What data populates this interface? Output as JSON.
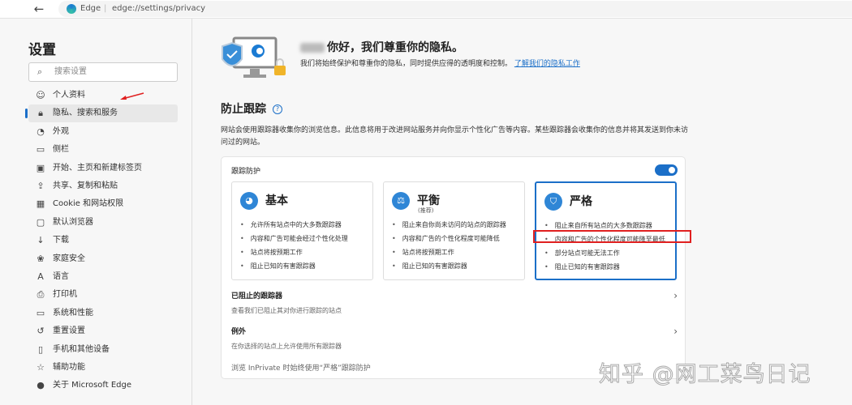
{
  "browser": {
    "brand": "Edge",
    "url": "edge://settings/privacy"
  },
  "sidebar": {
    "title": "设置",
    "search_placeholder": "搜索设置",
    "items": [
      {
        "label": "个人资料",
        "icon": "profile-icon"
      },
      {
        "label": "隐私、搜索和服务",
        "icon": "lock-icon"
      },
      {
        "label": "外观",
        "icon": "palette-icon"
      },
      {
        "label": "侧栏",
        "icon": "sidebar-icon"
      },
      {
        "label": "开始、主页和新建标签页",
        "icon": "home-icon"
      },
      {
        "label": "共享、复制和粘贴",
        "icon": "share-icon"
      },
      {
        "label": "Cookie 和网站权限",
        "icon": "cookie-icon"
      },
      {
        "label": "默认浏览器",
        "icon": "browser-icon"
      },
      {
        "label": "下载",
        "icon": "download-icon"
      },
      {
        "label": "家庭安全",
        "icon": "family-icon"
      },
      {
        "label": "语言",
        "icon": "language-icon"
      },
      {
        "label": "打印机",
        "icon": "printer-icon"
      },
      {
        "label": "系统和性能",
        "icon": "laptop-icon"
      },
      {
        "label": "重置设置",
        "icon": "reset-icon"
      },
      {
        "label": "手机和其他设备",
        "icon": "phone-icon"
      },
      {
        "label": "辅助功能",
        "icon": "accessibility-icon"
      },
      {
        "label": "关于 Microsoft Edge",
        "icon": "edge-icon"
      }
    ]
  },
  "hero": {
    "title": "你好，我们尊重你的隐私。",
    "desc": "我们将始终保护和尊重你的隐私，同时提供应得的透明度和控制。",
    "link": "了解我们的隐私工作"
  },
  "tracking": {
    "title": "防止跟踪",
    "desc": "网站会使用跟踪器收集你的浏览信息。此信息将用于改进网站服务并向你显示个性化广告等内容。某些跟踪器会收集你的信息并将其发送到你未访问过的网站。",
    "toggle_label": "跟踪防护",
    "toggle_on": true,
    "levels": [
      {
        "name": "基本",
        "sub": "",
        "bullets": [
          "允许所有站点中的大多数跟踪器",
          "内容和广告可能会经过个性化处理",
          "站点将按预期工作",
          "阻止已知的有害跟踪器"
        ]
      },
      {
        "name": "平衡",
        "sub": "(推荐)",
        "bullets": [
          "阻止来自你尚未访问的站点的跟踪器",
          "内容和广告的个性化程度可能降低",
          "站点将按预期工作",
          "阻止已知的有害跟踪器"
        ]
      },
      {
        "name": "严格",
        "sub": "",
        "bullets": [
          "阻止来自所有站点的大多数跟踪器",
          "内容和广告的个性化程度可能降至最低",
          "部分站点可能无法工作",
          "阻止已知的有害跟踪器"
        ]
      }
    ],
    "selected": "严格",
    "blocked": {
      "title": "已阻止的跟踪器",
      "desc": "查看我们已阻止其对你进行跟踪的站点"
    },
    "exceptions": {
      "title": "例外",
      "desc": "在你选择的站点上允许使用所有跟踪器"
    },
    "inprivate": "浏览 InPrivate 时始终使用“严格”跟踪防护"
  },
  "watermark": "知乎 @网工菜鸟日记",
  "colors": {
    "accent": "#1b6fc8",
    "annotation": "#e02020"
  }
}
